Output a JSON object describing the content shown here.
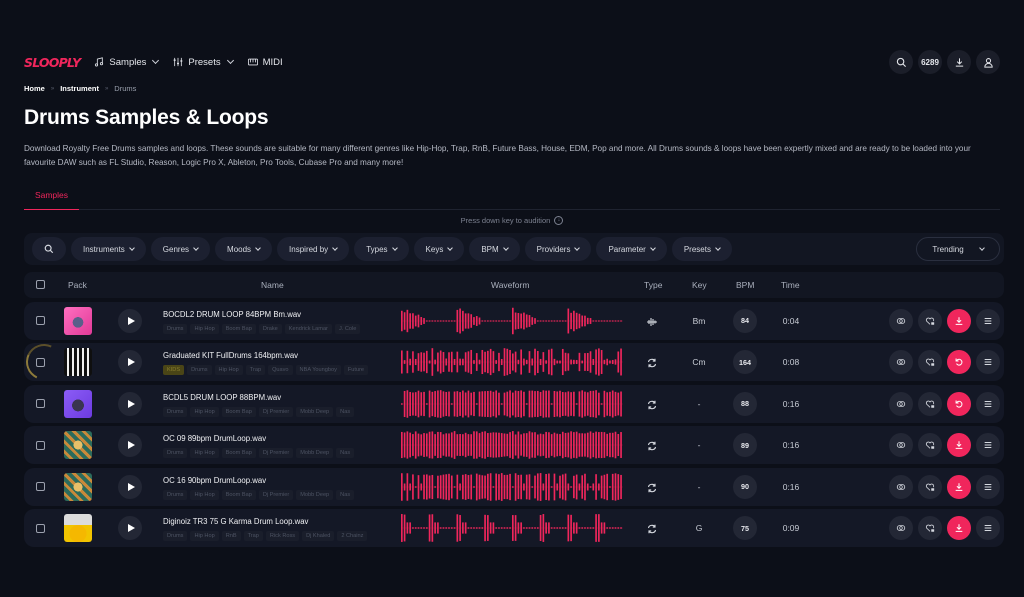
{
  "brand": {
    "logo": "SLOOPLY",
    "accent": "#f0265c"
  },
  "nav": {
    "items": [
      {
        "label": "Samples",
        "icon": "music-note-icon",
        "dropdown": true
      },
      {
        "label": "Presets",
        "icon": "sliders-icon",
        "dropdown": true
      },
      {
        "label": "MIDI",
        "icon": "keyboard-icon",
        "dropdown": false
      }
    ],
    "right": {
      "search_icon": "search-icon",
      "credits": "6289",
      "download_icon": "download-icon",
      "user_icon": "user-icon"
    }
  },
  "breadcrumb": [
    {
      "label": "Home"
    },
    {
      "label": "Instrument"
    },
    {
      "label": "Drums"
    }
  ],
  "breadcrumb_sep": "»",
  "page": {
    "title": "Drums Samples & Loops",
    "description": "Download Royalty Free Drums samples and loops. These sounds are suitable for many different genres like Hip-Hop, Trap, RnB, Future Bass, House, EDM, Pop and more. All Drums sounds & loops have been expertly mixed and are ready to be loaded into your favourite DAW such as FL Studio, Reason, Logic Pro X, Ableton, Pro Tools, Cubase Pro and many more!"
  },
  "tabs": [
    {
      "label": "Samples",
      "active": true
    }
  ],
  "hint": "Press down key to audition",
  "filters": [
    "Instruments",
    "Genres",
    "Moods",
    "Inspired by",
    "Types",
    "Keys",
    "BPM",
    "Providers",
    "Parameter",
    "Presets"
  ],
  "sort": {
    "selected": "Trending"
  },
  "table": {
    "headers": {
      "pack": "Pack",
      "name": "Name",
      "waveform": "Waveform",
      "type": "Type",
      "key": "Key",
      "bpm": "BPM",
      "time": "Time"
    },
    "rows": [
      {
        "name": "BOCDL2 DRUM LOOP 84BPM Bm.wav",
        "tags": [
          "Drums",
          "Hip Hop",
          "Boom Bap",
          "Drake",
          "Kendrick Lamar",
          "J. Cole"
        ],
        "highlight_tag": null,
        "type": "one-shot",
        "key": "Bm",
        "bpm": "84",
        "time": "0:04",
        "action": "download",
        "art": "pink",
        "wave": "sparse",
        "loading": false
      },
      {
        "name": "Graduated KIT FullDrums 164bpm.wav",
        "tags": [
          "Drums",
          "Hip Hop",
          "Trap",
          "Quavo",
          "NBA Youngboy",
          "Future"
        ],
        "highlight_tag": "KIDS",
        "type": "loop",
        "key": "Cm",
        "bpm": "164",
        "time": "0:08",
        "action": "redownload",
        "art": "bw",
        "wave": "mixed",
        "loading": true
      },
      {
        "name": "BCDL5 DRUM LOOP 88BPM.wav",
        "tags": [
          "Drums",
          "Hip Hop",
          "Boom Bap",
          "Dj Premier",
          "Mobb Deep",
          "Nas"
        ],
        "highlight_tag": null,
        "type": "loop",
        "key": "-",
        "bpm": "88",
        "time": "0:16",
        "action": "redownload",
        "art": "purple",
        "wave": "dense",
        "loading": false
      },
      {
        "name": "OC 09 89bpm DrumLoop.wav",
        "tags": [
          "Drums",
          "Hip Hop",
          "Boom Bap",
          "Dj Premier",
          "Mobb Deep",
          "Nas"
        ],
        "highlight_tag": null,
        "type": "loop",
        "key": "-",
        "bpm": "89",
        "time": "0:16",
        "action": "download",
        "art": "green",
        "wave": "full",
        "loading": false
      },
      {
        "name": "OC 16 90bpm DrumLoop.wav",
        "tags": [
          "Drums",
          "Hip Hop",
          "Boom Bap",
          "Dj Premier",
          "Mobb Deep",
          "Nas"
        ],
        "highlight_tag": null,
        "type": "loop",
        "key": "-",
        "bpm": "90",
        "time": "0:16",
        "action": "download",
        "art": "green",
        "wave": "groups",
        "loading": false
      },
      {
        "name": "Diginoiz TR3 75 G Karma Drum Loop.wav",
        "tags": [
          "Drums",
          "Hip Hop",
          "RnB",
          "Trap",
          "Rick Ross",
          "Dj Khaled",
          "2 Chainz"
        ],
        "highlight_tag": null,
        "type": "loop",
        "key": "G",
        "bpm": "75",
        "time": "0:09",
        "action": "download",
        "art": "yellow",
        "wave": "sparse2",
        "loading": false
      }
    ]
  }
}
